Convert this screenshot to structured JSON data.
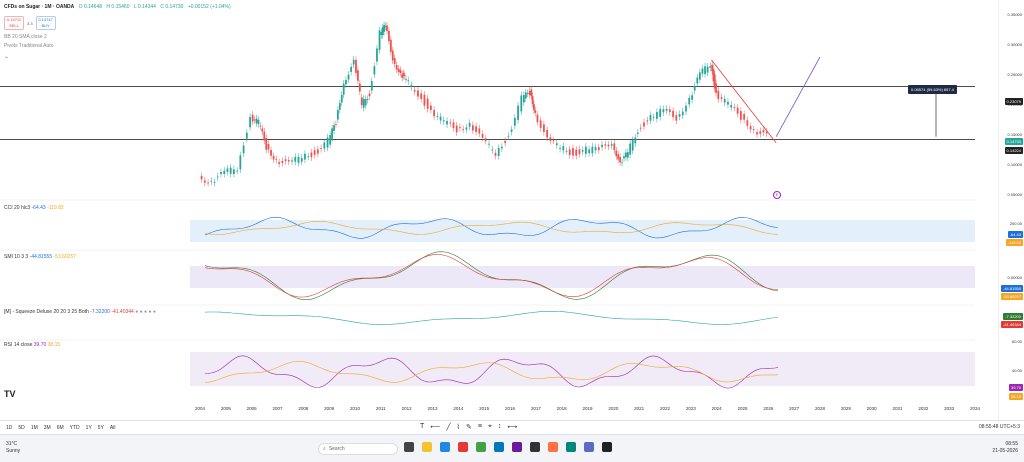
{
  "header": {
    "symbol": "CFDs on Sugar · 1M · OANDA",
    "open": "O 0.14648",
    "high": "H 0.15460",
    "low": "L 0.14344",
    "close": "C 0.14730",
    "change": "+0.00152 (+1.04%)"
  },
  "trade": {
    "sell_price": "0.14711",
    "sell_label": "SELL",
    "mid": "3.3",
    "buy_price": "0.14747",
    "buy_label": "BUY"
  },
  "indicators_top": {
    "bb": "BB 20 SMA close 2",
    "pivots": "Pivots Traditional Auto"
  },
  "price_scale": {
    "ticks": [
      "0.35000",
      "0.30000",
      "0.25000",
      "0.20000",
      "0.15000",
      "0.10000",
      "0.05000"
    ],
    "level_upper": "0.23079",
    "current": "0.14730",
    "level_lower": "0.14224",
    "current_label": "SUGARUSD"
  },
  "measure": {
    "label": "0.08574 (59.63%) 857.4"
  },
  "panes": {
    "cci": {
      "name": "CCI 20 hlc3",
      "v1": "-64.43",
      "v2": "-119.82",
      "scale_top": "200.00",
      "tag1": "-64.43",
      "tag2": "-119.82"
    },
    "smi": {
      "name": "SMI 10 3 3",
      "v1": "-44.81555",
      "v2": "-53.60257",
      "scale_top": "0.00000",
      "tag1": "-44.81555",
      "tag2": "-53.60257"
    },
    "squeeze": {
      "name": "[M] - Squeeze Deluxe 20 20 3 25 Both",
      "v1": "-7.32200",
      "v2": "-41.40344",
      "tag1": "-7.32200",
      "tag2": "-41.40344"
    },
    "rsi": {
      "name": "RSI 14 close",
      "v1": "39.70",
      "v2": "38.15",
      "scale_top": "60.00",
      "scale_mid": "40.00",
      "tag1": "39.70",
      "tag2": "38.15"
    }
  },
  "year_axis": [
    "2004",
    "2005",
    "2006",
    "2007",
    "2008",
    "2009",
    "2010",
    "2011",
    "2012",
    "2013",
    "2014",
    "2015",
    "2016",
    "2017",
    "2018",
    "2019",
    "2020",
    "2021",
    "2022",
    "2023",
    "2024",
    "2025",
    "2026",
    "2027",
    "2028",
    "2029",
    "2030",
    "2031",
    "2032",
    "2033",
    "2034"
  ],
  "timeframes": [
    "1D",
    "5D",
    "1M",
    "3M",
    "6M",
    "YTD",
    "1Y",
    "5Y",
    "All"
  ],
  "clock": "08:55:48 UTC+5:3",
  "logo": "TV",
  "marker": "E",
  "taskbar": {
    "temp": "31°C",
    "weather": "Sunny",
    "search_placeholder": "Search",
    "time": "08:55",
    "date": "21-05-2026"
  },
  "chart_data": {
    "type": "candlestick",
    "title": "CFDs on Sugar · 1M · OANDA",
    "x_range": [
      2004,
      2034
    ],
    "y_range": [
      0.05,
      0.35
    ],
    "series": [
      {
        "values": [
          [
            2004.0,
            0.081
          ],
          [
            2004.5,
            0.072
          ],
          [
            2005.0,
            0.086
          ],
          [
            2005.5,
            0.096
          ],
          [
            2006.0,
            0.18
          ],
          [
            2006.3,
            0.17
          ],
          [
            2006.6,
            0.13
          ],
          [
            2007.0,
            0.11
          ],
          [
            2007.5,
            0.1
          ],
          [
            2008.0,
            0.115
          ],
          [
            2008.5,
            0.12
          ],
          [
            2009.0,
            0.14
          ],
          [
            2009.3,
            0.17
          ],
          [
            2009.6,
            0.24
          ],
          [
            2010.0,
            0.27
          ],
          [
            2010.3,
            0.2
          ],
          [
            2010.6,
            0.22
          ],
          [
            2011.0,
            0.32
          ],
          [
            2011.2,
            0.33
          ],
          [
            2011.5,
            0.28
          ],
          [
            2011.8,
            0.25
          ],
          [
            2012.0,
            0.24
          ],
          [
            2012.5,
            0.22
          ],
          [
            2013.0,
            0.19
          ],
          [
            2013.5,
            0.17
          ],
          [
            2014.0,
            0.16
          ],
          [
            2014.5,
            0.17
          ],
          [
            2015.0,
            0.14
          ],
          [
            2015.5,
            0.12
          ],
          [
            2016.0,
            0.15
          ],
          [
            2016.5,
            0.21
          ],
          [
            2016.8,
            0.22
          ],
          [
            2017.0,
            0.19
          ],
          [
            2017.5,
            0.14
          ],
          [
            2018.0,
            0.13
          ],
          [
            2018.5,
            0.12
          ],
          [
            2019.0,
            0.125
          ],
          [
            2019.5,
            0.125
          ],
          [
            2020.0,
            0.14
          ],
          [
            2020.3,
            0.1
          ],
          [
            2020.6,
            0.12
          ],
          [
            2021.0,
            0.16
          ],
          [
            2021.5,
            0.18
          ],
          [
            2022.0,
            0.19
          ],
          [
            2022.5,
            0.18
          ],
          [
            2023.0,
            0.21
          ],
          [
            2023.4,
            0.25
          ],
          [
            2023.8,
            0.27
          ],
          [
            2024.0,
            0.22
          ],
          [
            2024.5,
            0.2
          ],
          [
            2025.0,
            0.18
          ],
          [
            2025.5,
            0.16
          ],
          [
            2026.0,
            0.147
          ]
        ]
      }
    ],
    "horizontal_levels": [
      0.23079,
      0.14224
    ],
    "trendline": [
      [
        2023.8,
        0.275
      ],
      [
        2026.3,
        0.137
      ]
    ],
    "projection": [
      [
        2026.3,
        0.147
      ],
      [
        2028.0,
        0.28
      ]
    ]
  }
}
